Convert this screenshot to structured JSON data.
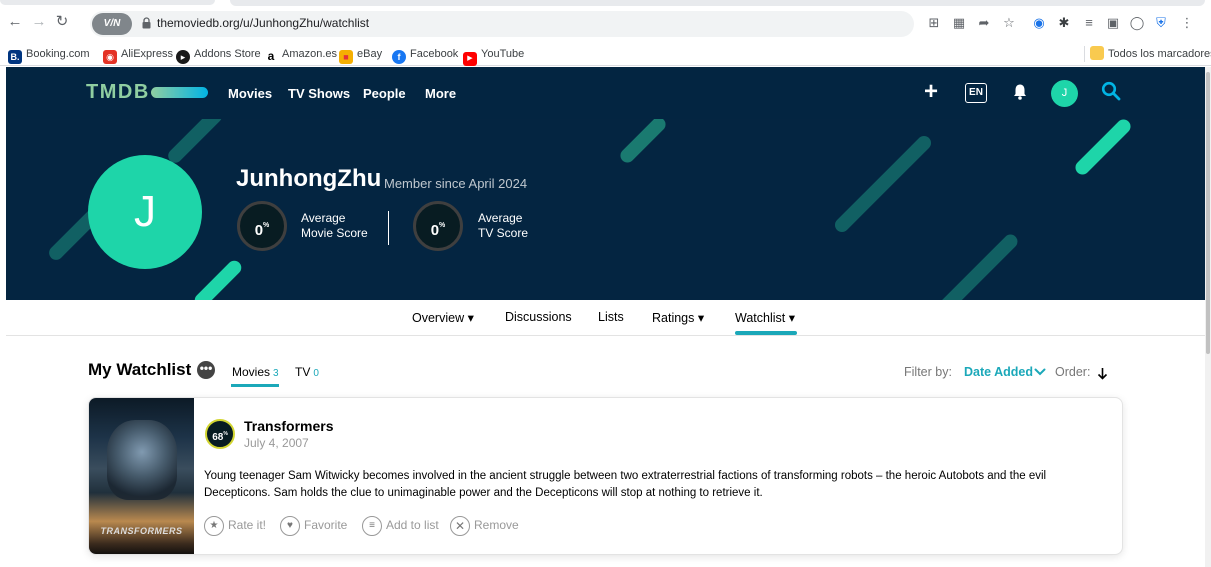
{
  "browser": {
    "url": "themoviedb.org/u/JunhongZhu/watchlist",
    "vpn_label": "V/⁠N",
    "bookmarks": [
      {
        "label": "Booking.com",
        "icon": "B.",
        "color": "#003580"
      },
      {
        "label": "AliExpress",
        "icon": "◉",
        "color": "#e43225"
      },
      {
        "label": "Addons Store",
        "icon": "●",
        "color": "#1a1a1a"
      },
      {
        "label": "Amazon.es",
        "icon": "a",
        "color": "#ffffff"
      },
      {
        "label": "eBay",
        "icon": "■",
        "color": "#f5af02"
      },
      {
        "label": "Facebook",
        "icon": "f",
        "color": "#1877f2"
      },
      {
        "label": "YouTube",
        "icon": "▶",
        "color": "#ff0000"
      }
    ],
    "all_bookmarks": "Todos los marcadores"
  },
  "site": {
    "logo": "TMDB",
    "nav": [
      "Movies",
      "TV Shows",
      "People",
      "More"
    ],
    "lang": "EN",
    "avatar_letter": "J",
    "colors": {
      "navy": "#032541",
      "accent": "#1ed5a9",
      "teal": "#1ba8b9"
    }
  },
  "profile": {
    "avatar_letter": "J",
    "username": "JunhongZhu",
    "member_since": "Member since April 2024",
    "movie_score": "0",
    "movie_score_label_1": "Average",
    "movie_score_label_2": "Movie Score",
    "tv_score": "0",
    "tv_score_label_1": "Average",
    "tv_score_label_2": "TV Score",
    "percent": "%"
  },
  "subnav": [
    "Overview ▾",
    "Discussions",
    "Lists",
    "Ratings ▾",
    "Watchlist ▾"
  ],
  "watchlist": {
    "title": "My Watchlist",
    "more": "•••",
    "tabs": [
      {
        "label": "Movies",
        "count": "3"
      },
      {
        "label": "TV",
        "count": "0"
      }
    ],
    "filter_label": "Filter by:",
    "filter_value": "Date Added",
    "order_label": "Order:"
  },
  "items": [
    {
      "score": "68",
      "percent": "%",
      "title": "Transformers",
      "date": "July 4, 2007",
      "overview": "Young teenager Sam Witwicky becomes involved in the ancient struggle between two extraterrestrial factions of transforming robots – the heroic Autobots and the evil Decepticons. Sam holds the clue to unimaginable power and the Decepticons will stop at nothing to retrieve it.",
      "poster_text": "TRANSFORMERS",
      "actions": {
        "rate": "Rate it!",
        "favorite": "Favorite",
        "add_to_list": "Add to list",
        "remove": "Remove"
      }
    }
  ]
}
